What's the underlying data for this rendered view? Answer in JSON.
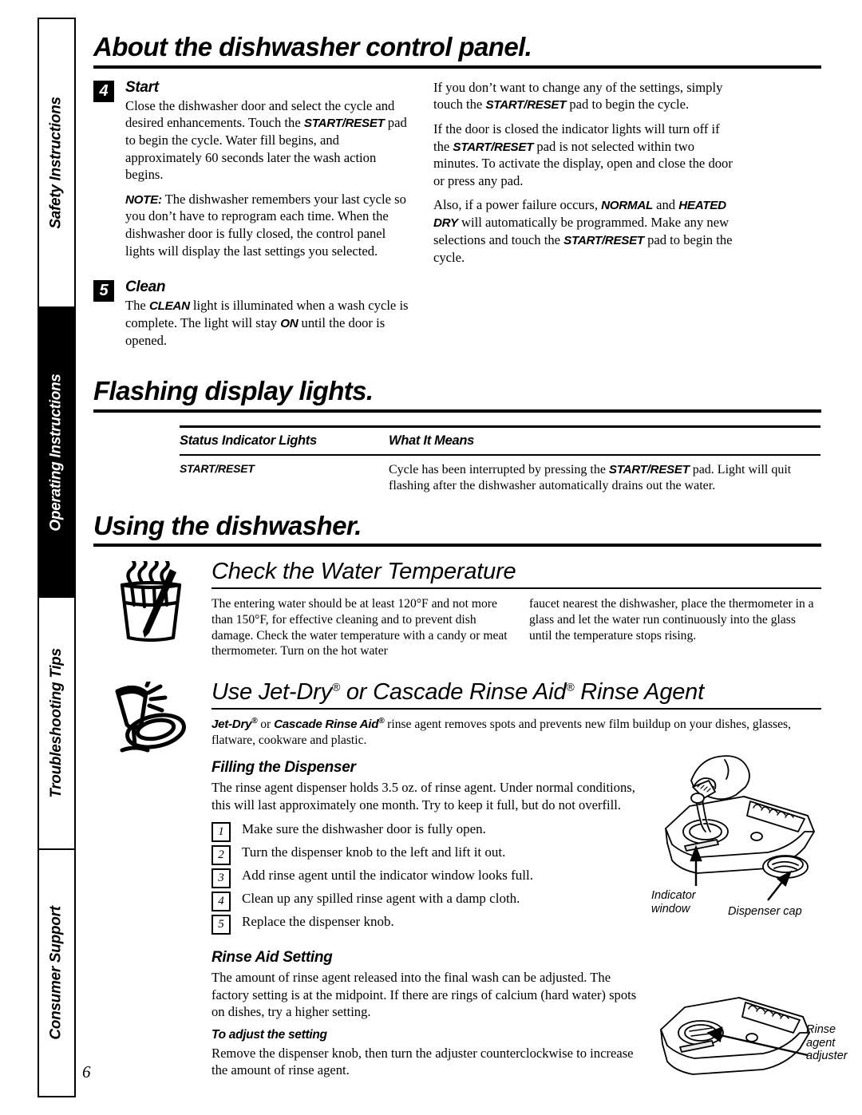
{
  "page": {
    "number": "6"
  },
  "sidebar": {
    "tabs": [
      {
        "label": "Safety Instructions",
        "active": false
      },
      {
        "label": "Operating Instructions",
        "active": true
      },
      {
        "label": "Troubleshooting Tips",
        "active": false
      },
      {
        "label": "Consumer Support",
        "active": false
      }
    ]
  },
  "sections": {
    "control_panel": {
      "title": "About the dishwasher control panel.",
      "steps": [
        {
          "number": "4",
          "heading": "Start",
          "paragraph1_a": "Close the dishwasher door and select the cycle and desired enhancements. Touch the ",
          "paragraph1_b": "START/RESET",
          "paragraph1_c": " pad to begin the cycle. Water fill begins, and approximately 60 seconds later the wash action begins.",
          "note_label": "NOTE:",
          "note_text": " The dishwasher remembers your last cycle so you don’t have to reprogram each time. When the dishwasher door is fully closed, the control panel lights will display the last settings you selected."
        },
        {
          "number": "5",
          "heading": "Clean",
          "text_a": "The ",
          "text_b": "CLEAN",
          "text_c": " light is illuminated when a wash cycle is complete. The light will stay ",
          "text_d": "ON",
          "text_e": " until the door is opened."
        }
      ],
      "right_column": {
        "p1_a": "If you don’t want to change any of the settings, simply touch the ",
        "p1_b": "START/RESET",
        "p1_c": " pad to begin the cycle.",
        "p2_a": "If the door is closed the indicator lights will turn off if the ",
        "p2_b": "START/RESET",
        "p2_c": " pad is not selected within two minutes. To activate the display, open and close the door or press any pad.",
        "p3_a": "Also, if a power failure occurs, ",
        "p3_b": "NORMAL",
        "p3_c": " and ",
        "p3_d": "HEATED DRY",
        "p3_e": " will automatically be programmed. Make any new selections and touch the ",
        "p3_f": "START/RESET",
        "p3_g": " pad to begin the cycle."
      }
    },
    "flashing_lights": {
      "title": "Flashing display lights.",
      "table": {
        "headers": [
          "Status Indicator Lights",
          "What It Means"
        ],
        "rows": [
          {
            "indicator": "START/RESET",
            "meaning_a": "Cycle has been interrupted by pressing the ",
            "meaning_b": "START/RESET",
            "meaning_c": " pad. Light will quit flashing after the dishwasher automatically drains out the water."
          }
        ]
      }
    },
    "using_dishwasher": {
      "title": "Using the dishwasher.",
      "water_temperature": {
        "heading": "Check the Water Temperature",
        "col_left": "The entering water should be at least 120°F and not more than 150°F, for effective cleaning and to prevent dish damage. Check the water temperature with a candy or meat thermometer. Turn on the hot water",
        "col_right": "faucet nearest the dishwasher, place the thermometer in a glass and let the water run continuously into the glass until the temperature stops rising."
      },
      "rinse_agent": {
        "heading_a": "Use Jet-Dry",
        "heading_reg1": "®",
        "heading_b": " or Cascade Rinse Aid",
        "heading_reg2": "®",
        "heading_c": " Rinse Agent",
        "intro_a": "Jet-Dry",
        "intro_reg1": "®",
        "intro_b": " or ",
        "intro_c": "Cascade Rinse Aid",
        "intro_reg2": "®",
        "intro_d": " rinse agent removes spots and prevents new film buildup on your dishes, glasses, flatware, cookware and plastic.",
        "filling": {
          "heading": "Filling the Dispenser",
          "intro": "The rinse agent dispenser holds 3.5 oz. of rinse agent. Under normal conditions, this will last approximately one month. Try to keep it full, but do not overfill.",
          "steps": [
            {
              "number": "1",
              "text": "Make sure the dishwasher door is fully open."
            },
            {
              "number": "2",
              "text": "Turn the dispenser knob to the left and lift it out."
            },
            {
              "number": "3",
              "text": "Add rinse agent until the indicator window looks full."
            },
            {
              "number": "4",
              "text": "Clean up any spilled rinse agent with a damp cloth."
            },
            {
              "number": "5",
              "text": "Replace the dispenser knob."
            }
          ]
        },
        "setting": {
          "heading": "Rinse Aid Setting",
          "body": "The amount of rinse agent released into the final wash can be adjusted. The factory setting is at the midpoint. If there are rings of calcium (hard water) spots on dishes, try a higher setting.",
          "adjust_heading": "To adjust the setting",
          "adjust_body": "Remove the dispenser knob, then turn the adjuster counterclockwise to increase the amount of rinse agent."
        }
      }
    }
  },
  "figures": {
    "dispenser_fill": {
      "label_indicator": "Indicator\nwindow",
      "label_cap": "Dispenser cap"
    },
    "dispenser_adjust": {
      "label_adjuster": "Rinse\nagent\nadjuster"
    }
  }
}
